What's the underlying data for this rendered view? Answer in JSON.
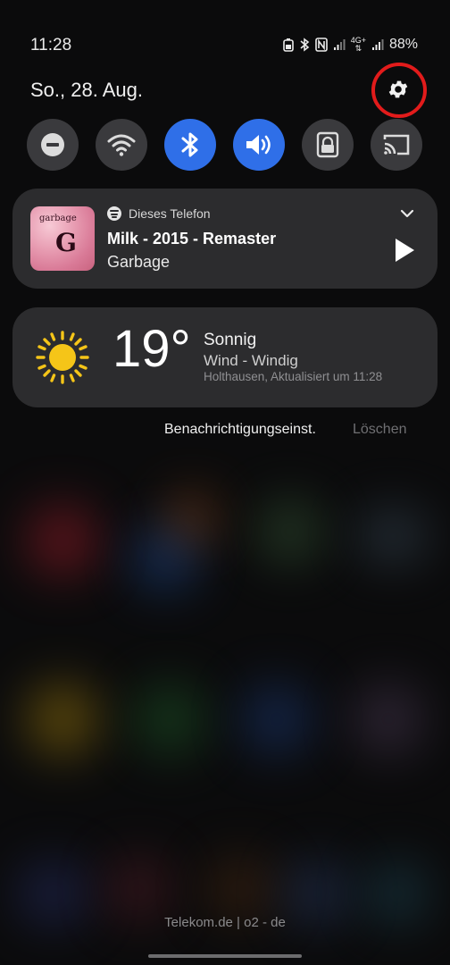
{
  "status_bar": {
    "time": "11:28",
    "battery": "88%",
    "network": "4G+"
  },
  "header": {
    "date": "So., 28. Aug.",
    "settings_icon": "gear-icon",
    "highlight_color": "#e21b1b"
  },
  "quick_toggles": [
    {
      "name": "do-not-disturb",
      "icon": "minus-circle-icon",
      "active": false
    },
    {
      "name": "wifi",
      "icon": "wifi-icon",
      "active": false
    },
    {
      "name": "bluetooth",
      "icon": "bluetooth-icon",
      "active": true
    },
    {
      "name": "sound",
      "icon": "volume-icon",
      "active": true
    },
    {
      "name": "lock",
      "icon": "lock-icon",
      "active": false
    },
    {
      "name": "cast",
      "icon": "cast-icon",
      "active": false
    }
  ],
  "media": {
    "source": "Dieses Telefon",
    "title": "Milk - 2015 - Remaster",
    "artist": "Garbage",
    "album_band": "garbage",
    "album_letter": "G"
  },
  "weather": {
    "temperature": "19°",
    "condition": "Sonnig",
    "wind": "Wind - Windig",
    "location": "Holthausen, Aktualisiert um 11:28"
  },
  "actions": {
    "notification_settings": "Benachrichtigungseinst.",
    "clear": "Löschen"
  },
  "footer": {
    "carrier": "Telekom.de | o2 - de"
  },
  "colors": {
    "accent_active": "#2f6fe8",
    "card": "#2c2c2e",
    "sun": "#f5c518"
  }
}
